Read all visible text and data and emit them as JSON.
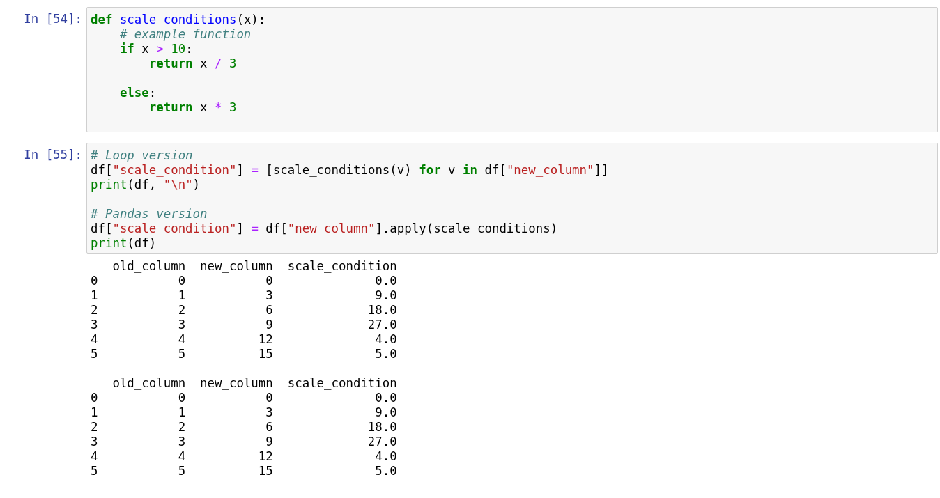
{
  "cells": [
    {
      "prompt": "In [54]:",
      "code": [
        {
          "kind": "code",
          "tokens": [
            {
              "kind": "kw",
              "text": "def"
            },
            {
              "kind": "fn",
              "text": " scale_conditions"
            },
            {
              "kind": "plain",
              "text": "(x):"
            }
          ]
        },
        {
          "kind": "code",
          "tokens": [
            {
              "kind": "comment",
              "text": "    # example function"
            }
          ]
        },
        {
          "kind": "code",
          "tokens": [
            {
              "kind": "kw",
              "text": "    if"
            },
            {
              "kind": "plain",
              "text": " x "
            },
            {
              "kind": "op",
              "text": ">"
            },
            {
              "kind": "num",
              "text": " 10"
            },
            {
              "kind": "plain",
              "text": ":"
            }
          ]
        },
        {
          "kind": "code",
          "tokens": [
            {
              "kind": "kw",
              "text": "        return"
            },
            {
              "kind": "plain",
              "text": " x "
            },
            {
              "kind": "op",
              "text": "/"
            },
            {
              "kind": "num",
              "text": " 3"
            }
          ]
        },
        {
          "kind": "blank"
        },
        {
          "kind": "code",
          "tokens": [
            {
              "kind": "kw",
              "text": "    else"
            },
            {
              "kind": "plain",
              "text": ":"
            }
          ]
        },
        {
          "kind": "code",
          "tokens": [
            {
              "kind": "kw",
              "text": "        return"
            },
            {
              "kind": "plain",
              "text": " x "
            },
            {
              "kind": "op",
              "text": "*"
            },
            {
              "kind": "num",
              "text": " 3"
            }
          ]
        },
        {
          "kind": "blank"
        }
      ]
    },
    {
      "prompt": "In [55]:",
      "code": [
        {
          "kind": "code",
          "tokens": [
            {
              "kind": "comment",
              "text": "# Loop version"
            }
          ]
        },
        {
          "kind": "code",
          "tokens": [
            {
              "kind": "plain",
              "text": "df["
            },
            {
              "kind": "str",
              "text": "\"scale_condition\""
            },
            {
              "kind": "plain",
              "text": "] "
            },
            {
              "kind": "op",
              "text": "="
            },
            {
              "kind": "plain",
              "text": " [scale_conditions(v) "
            },
            {
              "kind": "kw",
              "text": "for"
            },
            {
              "kind": "plain",
              "text": " v "
            },
            {
              "kind": "kw",
              "text": "in"
            },
            {
              "kind": "plain",
              "text": " df["
            },
            {
              "kind": "str",
              "text": "\"new_column\""
            },
            {
              "kind": "plain",
              "text": "]]"
            }
          ]
        },
        {
          "kind": "code",
          "tokens": [
            {
              "kind": "builtin",
              "text": "print"
            },
            {
              "kind": "plain",
              "text": "(df, "
            },
            {
              "kind": "str",
              "text": "\"\\n\""
            },
            {
              "kind": "plain",
              "text": ")"
            }
          ]
        },
        {
          "kind": "blank"
        },
        {
          "kind": "code",
          "tokens": [
            {
              "kind": "comment",
              "text": "# Pandas version"
            }
          ]
        },
        {
          "kind": "code",
          "tokens": [
            {
              "kind": "plain",
              "text": "df["
            },
            {
              "kind": "str",
              "text": "\"scale_condition\""
            },
            {
              "kind": "plain",
              "text": "] "
            },
            {
              "kind": "op",
              "text": "="
            },
            {
              "kind": "plain",
              "text": " df["
            },
            {
              "kind": "str",
              "text": "\"new_column\""
            },
            {
              "kind": "plain",
              "text": "].apply(scale_conditions)"
            }
          ]
        },
        {
          "kind": "code",
          "tokens": [
            {
              "kind": "builtin",
              "text": "print"
            },
            {
              "kind": "plain",
              "text": "(df)"
            }
          ]
        }
      ],
      "output": [
        {
          "kind": "text",
          "text": "   old_column  new_column  scale_condition"
        },
        {
          "kind": "text",
          "text": "0           0           0              0.0"
        },
        {
          "kind": "text",
          "text": "1           1           3              9.0"
        },
        {
          "kind": "text",
          "text": "2           2           6             18.0"
        },
        {
          "kind": "text",
          "text": "3           3           9             27.0"
        },
        {
          "kind": "text",
          "text": "4           4          12              4.0"
        },
        {
          "kind": "text",
          "text": "5           5          15              5.0"
        },
        {
          "kind": "blank"
        },
        {
          "kind": "text",
          "text": "   old_column  new_column  scale_condition"
        },
        {
          "kind": "text",
          "text": "0           0           0              0.0"
        },
        {
          "kind": "text",
          "text": "1           1           3              9.0"
        },
        {
          "kind": "text",
          "text": "2           2           6             18.0"
        },
        {
          "kind": "text",
          "text": "3           3           9             27.0"
        },
        {
          "kind": "text",
          "text": "4           4          12              4.0"
        },
        {
          "kind": "text",
          "text": "5           5          15              5.0"
        }
      ]
    }
  ]
}
